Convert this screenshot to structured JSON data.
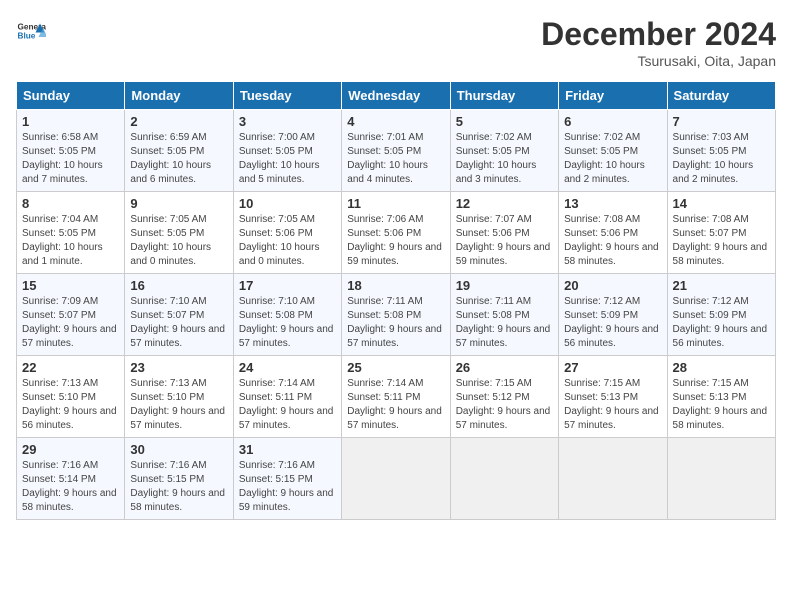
{
  "header": {
    "logo_general": "General",
    "logo_blue": "Blue",
    "month": "December 2024",
    "location": "Tsurusaki, Oita, Japan"
  },
  "weekdays": [
    "Sunday",
    "Monday",
    "Tuesday",
    "Wednesday",
    "Thursday",
    "Friday",
    "Saturday"
  ],
  "weeks": [
    [
      {
        "day": "1",
        "text": "Sunrise: 6:58 AM\nSunset: 5:05 PM\nDaylight: 10 hours and 7 minutes."
      },
      {
        "day": "2",
        "text": "Sunrise: 6:59 AM\nSunset: 5:05 PM\nDaylight: 10 hours and 6 minutes."
      },
      {
        "day": "3",
        "text": "Sunrise: 7:00 AM\nSunset: 5:05 PM\nDaylight: 10 hours and 5 minutes."
      },
      {
        "day": "4",
        "text": "Sunrise: 7:01 AM\nSunset: 5:05 PM\nDaylight: 10 hours and 4 minutes."
      },
      {
        "day": "5",
        "text": "Sunrise: 7:02 AM\nSunset: 5:05 PM\nDaylight: 10 hours and 3 minutes."
      },
      {
        "day": "6",
        "text": "Sunrise: 7:02 AM\nSunset: 5:05 PM\nDaylight: 10 hours and 2 minutes."
      },
      {
        "day": "7",
        "text": "Sunrise: 7:03 AM\nSunset: 5:05 PM\nDaylight: 10 hours and 2 minutes."
      }
    ],
    [
      {
        "day": "8",
        "text": "Sunrise: 7:04 AM\nSunset: 5:05 PM\nDaylight: 10 hours and 1 minute."
      },
      {
        "day": "9",
        "text": "Sunrise: 7:05 AM\nSunset: 5:05 PM\nDaylight: 10 hours and 0 minutes."
      },
      {
        "day": "10",
        "text": "Sunrise: 7:05 AM\nSunset: 5:06 PM\nDaylight: 10 hours and 0 minutes."
      },
      {
        "day": "11",
        "text": "Sunrise: 7:06 AM\nSunset: 5:06 PM\nDaylight: 9 hours and 59 minutes."
      },
      {
        "day": "12",
        "text": "Sunrise: 7:07 AM\nSunset: 5:06 PM\nDaylight: 9 hours and 59 minutes."
      },
      {
        "day": "13",
        "text": "Sunrise: 7:08 AM\nSunset: 5:06 PM\nDaylight: 9 hours and 58 minutes."
      },
      {
        "day": "14",
        "text": "Sunrise: 7:08 AM\nSunset: 5:07 PM\nDaylight: 9 hours and 58 minutes."
      }
    ],
    [
      {
        "day": "15",
        "text": "Sunrise: 7:09 AM\nSunset: 5:07 PM\nDaylight: 9 hours and 57 minutes."
      },
      {
        "day": "16",
        "text": "Sunrise: 7:10 AM\nSunset: 5:07 PM\nDaylight: 9 hours and 57 minutes."
      },
      {
        "day": "17",
        "text": "Sunrise: 7:10 AM\nSunset: 5:08 PM\nDaylight: 9 hours and 57 minutes."
      },
      {
        "day": "18",
        "text": "Sunrise: 7:11 AM\nSunset: 5:08 PM\nDaylight: 9 hours and 57 minutes."
      },
      {
        "day": "19",
        "text": "Sunrise: 7:11 AM\nSunset: 5:08 PM\nDaylight: 9 hours and 57 minutes."
      },
      {
        "day": "20",
        "text": "Sunrise: 7:12 AM\nSunset: 5:09 PM\nDaylight: 9 hours and 56 minutes."
      },
      {
        "day": "21",
        "text": "Sunrise: 7:12 AM\nSunset: 5:09 PM\nDaylight: 9 hours and 56 minutes."
      }
    ],
    [
      {
        "day": "22",
        "text": "Sunrise: 7:13 AM\nSunset: 5:10 PM\nDaylight: 9 hours and 56 minutes."
      },
      {
        "day": "23",
        "text": "Sunrise: 7:13 AM\nSunset: 5:10 PM\nDaylight: 9 hours and 57 minutes."
      },
      {
        "day": "24",
        "text": "Sunrise: 7:14 AM\nSunset: 5:11 PM\nDaylight: 9 hours and 57 minutes."
      },
      {
        "day": "25",
        "text": "Sunrise: 7:14 AM\nSunset: 5:11 PM\nDaylight: 9 hours and 57 minutes."
      },
      {
        "day": "26",
        "text": "Sunrise: 7:15 AM\nSunset: 5:12 PM\nDaylight: 9 hours and 57 minutes."
      },
      {
        "day": "27",
        "text": "Sunrise: 7:15 AM\nSunset: 5:13 PM\nDaylight: 9 hours and 57 minutes."
      },
      {
        "day": "28",
        "text": "Sunrise: 7:15 AM\nSunset: 5:13 PM\nDaylight: 9 hours and 58 minutes."
      }
    ],
    [
      {
        "day": "29",
        "text": "Sunrise: 7:16 AM\nSunset: 5:14 PM\nDaylight: 9 hours and 58 minutes."
      },
      {
        "day": "30",
        "text": "Sunrise: 7:16 AM\nSunset: 5:15 PM\nDaylight: 9 hours and 58 minutes."
      },
      {
        "day": "31",
        "text": "Sunrise: 7:16 AM\nSunset: 5:15 PM\nDaylight: 9 hours and 59 minutes."
      },
      null,
      null,
      null,
      null
    ]
  ]
}
